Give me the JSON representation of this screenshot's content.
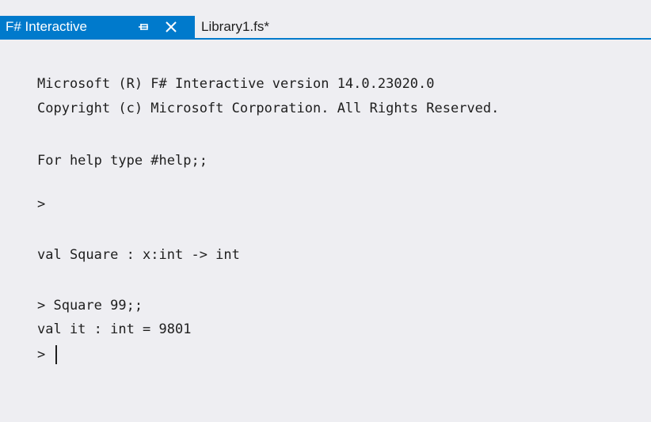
{
  "tabs": {
    "active": {
      "label": "F# Interactive",
      "pin_icon": "pin-icon",
      "close_icon": "close-icon"
    },
    "inactive": {
      "label": "Library1.fs*"
    }
  },
  "colors": {
    "accent": "#007acc",
    "background": "#eeeef2",
    "text": "#1e1e1e"
  },
  "console": {
    "lines": [
      "Microsoft (R) F# Interactive version 14.0.23020.0",
      "Copyright (c) Microsoft Corporation. All Rights Reserved.",
      "For help type #help;;",
      ">",
      "val Square : x:int -> int",
      "> Square 99;;",
      "val it : int = 9801",
      ">"
    ]
  }
}
